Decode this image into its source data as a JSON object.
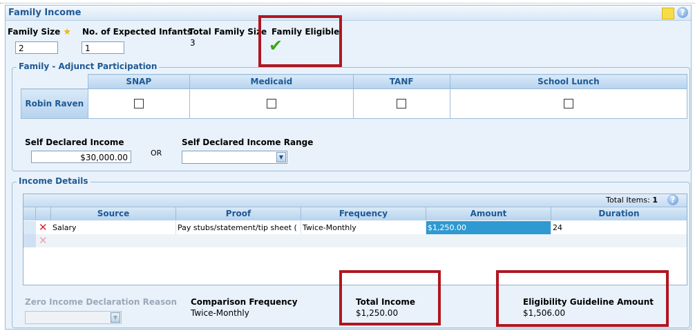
{
  "panel": {
    "title": "Family Income",
    "help_symbol": "?"
  },
  "family": {
    "size_label": "Family Size",
    "size_value": "2",
    "infants_label": "No. of Expected Infants",
    "infants_value": "1",
    "total_label": "Total Family Size",
    "total_value": "3",
    "eligible_label": "Family Eligible",
    "eligible_mark": "✔"
  },
  "adjunct": {
    "legend": "Family - Adjunct Participation",
    "columns": [
      "SNAP",
      "Medicaid",
      "TANF",
      "School Lunch"
    ],
    "member": "Robin Raven"
  },
  "income_declared": {
    "self_label": "Self Declared Income",
    "self_value": "$30,000.00",
    "or_text": "OR",
    "range_label": "Self Declared Income Range",
    "range_value": ""
  },
  "income_details": {
    "legend": "Income Details",
    "total_items_label": "Total Items:",
    "total_items_value": "1",
    "columns": [
      "Source",
      "Proof",
      "Frequency",
      "Amount",
      "Duration"
    ],
    "rows": [
      {
        "source": "Salary",
        "proof": "Pay stubs/statement/tip sheet (",
        "frequency": "Twice-Monthly",
        "amount": "$1,250.00",
        "duration": "24"
      }
    ]
  },
  "summary": {
    "zero_reason_label": "Zero Income Declaration Reason",
    "zero_reason_value": "",
    "comparison_label": "Comparison Frequency",
    "comparison_value": "Twice-Monthly",
    "total_income_label": "Total Income",
    "total_income_value": "$1,250.00",
    "guideline_label": "Eligibility Guideline Amount",
    "guideline_value": "$1,506.00"
  },
  "colors": {
    "accent": "#1e5a94",
    "highlight_red": "#b01620",
    "selection": "#2f9ad1",
    "check_green": "#3aa617"
  }
}
